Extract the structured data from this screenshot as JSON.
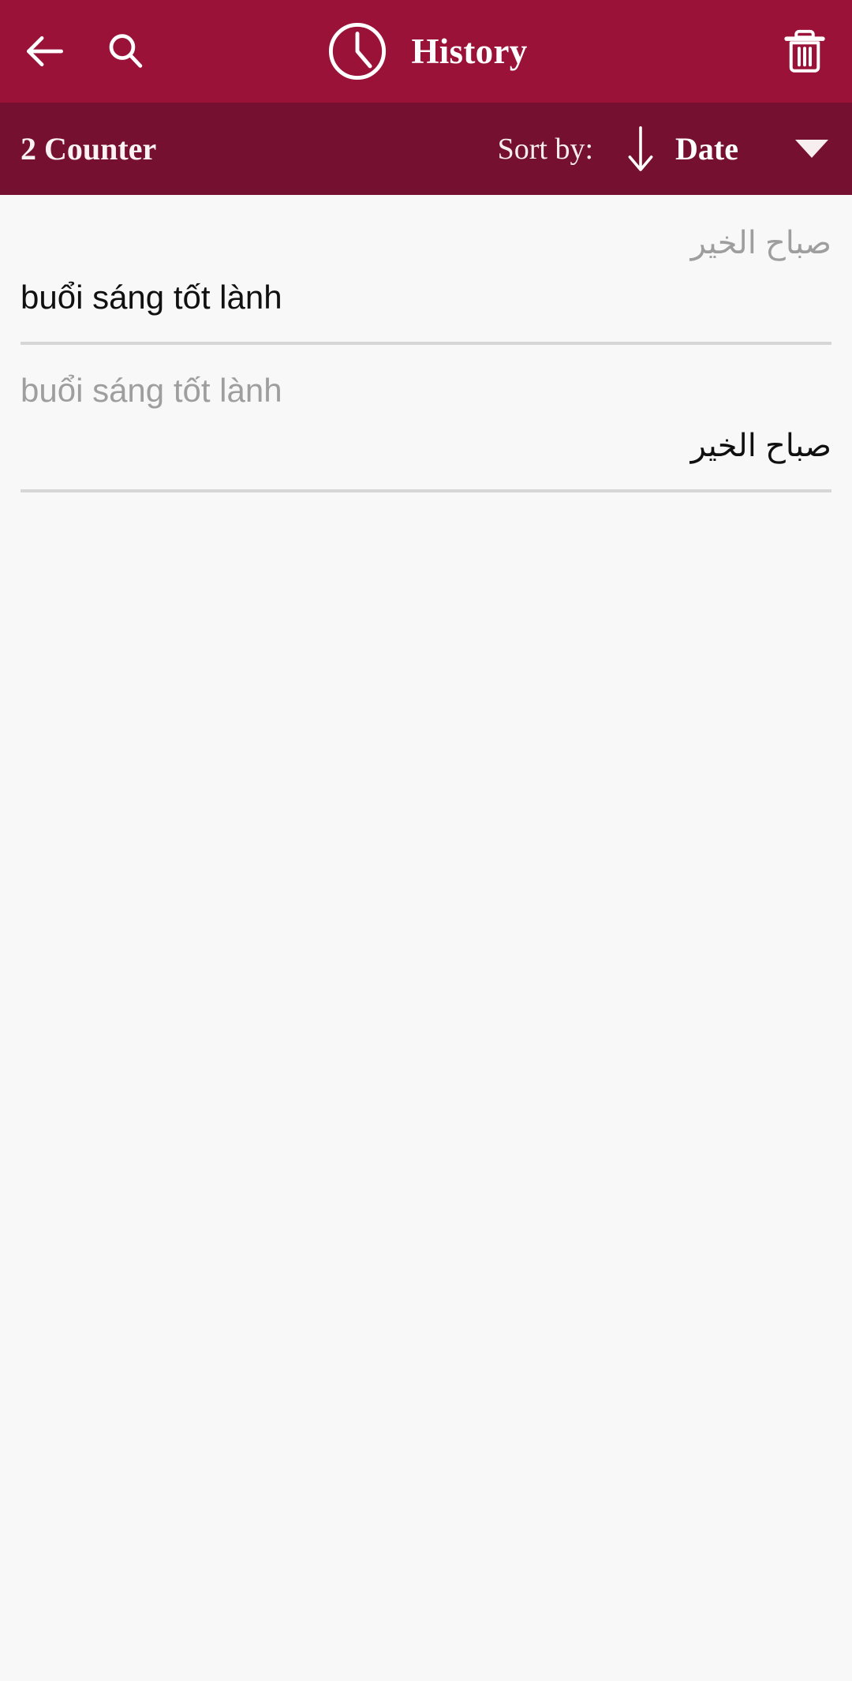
{
  "appbar": {
    "background_color": "#9B1239",
    "back_icon": "arrow-left-icon",
    "search_icon": "search-icon",
    "clock_icon": "clock-icon",
    "title": "History",
    "delete_icon": "trash-icon"
  },
  "sortbar": {
    "background_color": "#751030",
    "counter_label": "2 Counter",
    "sort_by_label": "Sort by:",
    "sort_direction_icon": "arrow-down-icon",
    "sort_direction": "descending",
    "sort_value": "Date",
    "dropdown_icon": "caret-down-icon"
  },
  "content": {
    "background_color": "#F8F8F8",
    "divider_color": "#D6D6D6",
    "source_text_color": "#9E9E9E",
    "target_text_color": "#101010",
    "items": [
      {
        "source_text": "صباح الخير",
        "source_dir": "rtl",
        "target_text": "buổi sáng tốt lành",
        "target_dir": "ltr"
      },
      {
        "source_text": "buổi sáng tốt lành",
        "source_dir": "ltr",
        "target_text": "صباح الخير",
        "target_dir": "rtl"
      }
    ]
  }
}
